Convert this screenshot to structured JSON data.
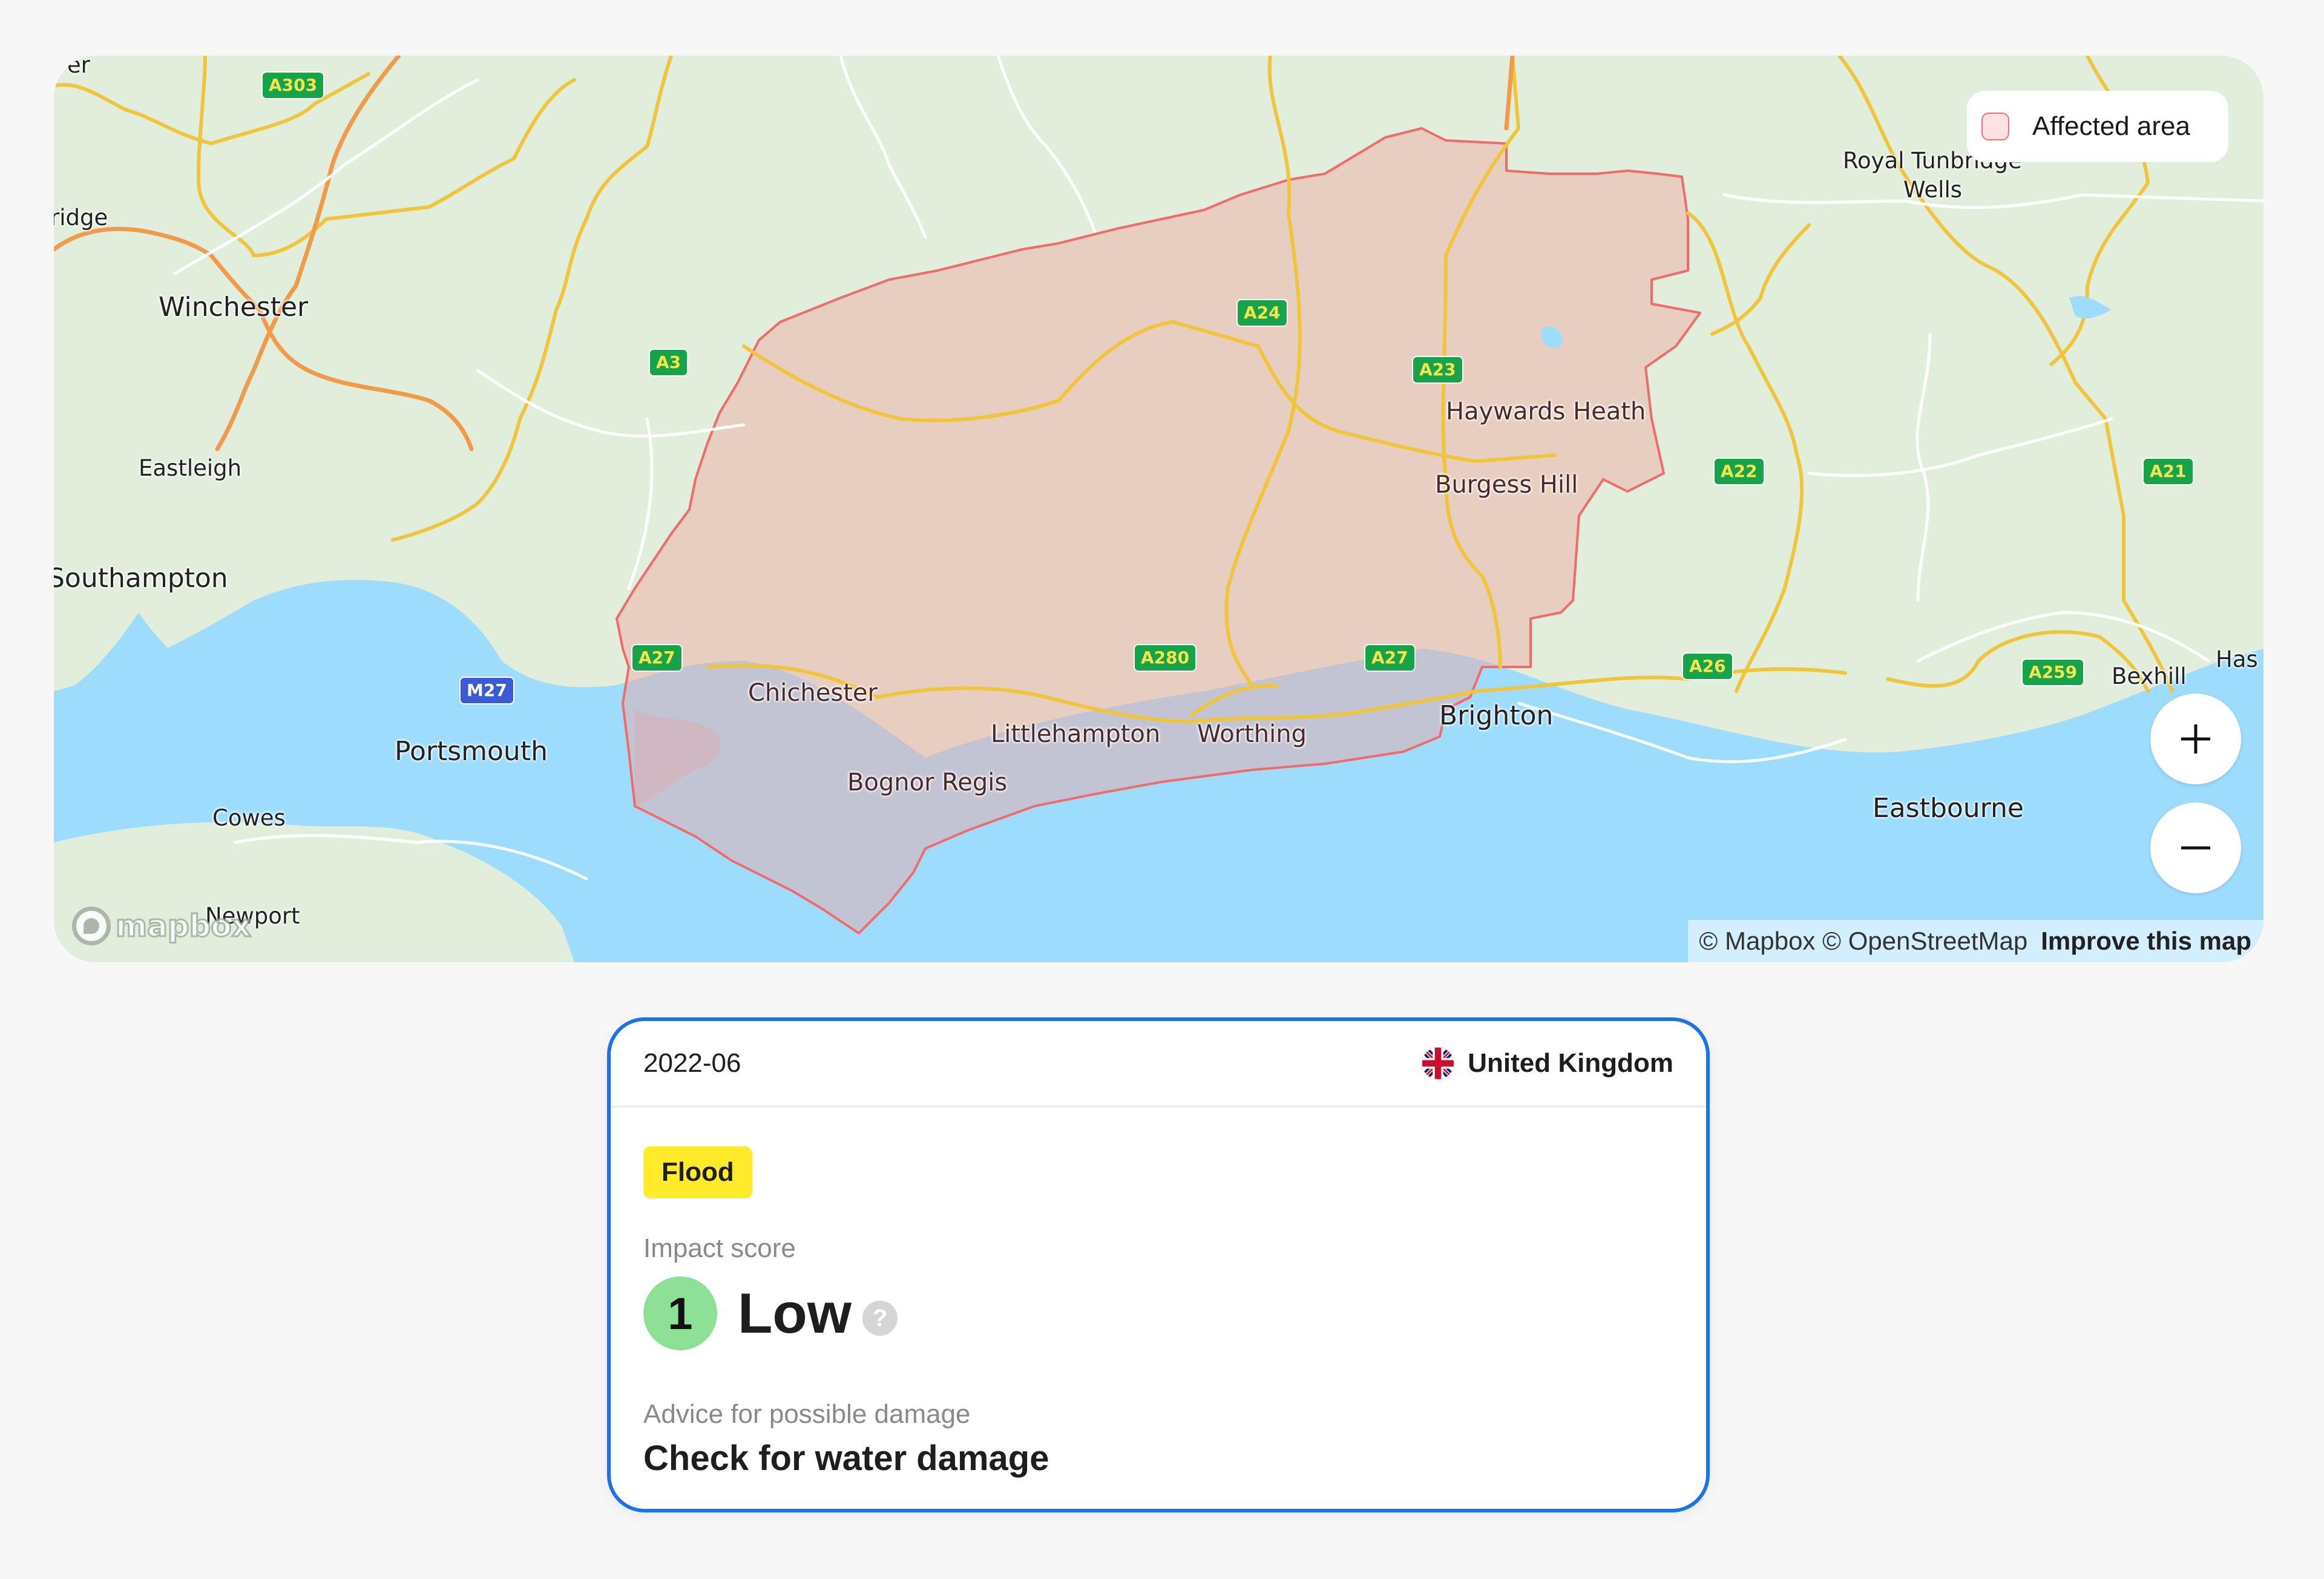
{
  "map": {
    "colors": {
      "land": "#e1eedb",
      "water": "#9ddcfd",
      "affected_fill": "#f2b8b4",
      "affected_stroke": "#f26b6b",
      "a_road": "#f0c53c",
      "motorway_like": "#f2994a"
    },
    "legend": {
      "label": "Affected area"
    },
    "places": [
      {
        "name": "Winchester",
        "size": "big"
      },
      {
        "name": "Eastleigh",
        "size": "small"
      },
      {
        "name": "Southampton",
        "size": "big"
      },
      {
        "name": "Portsmouth",
        "size": "big"
      },
      {
        "name": "Cowes",
        "size": "small"
      },
      {
        "name": "Newport",
        "size": "small"
      },
      {
        "name": "ridge",
        "size": "small"
      },
      {
        "name": "ver",
        "size": "small"
      },
      {
        "name": "Chichester",
        "size": "mid"
      },
      {
        "name": "Bognor Regis",
        "size": "mid"
      },
      {
        "name": "Littlehampton",
        "size": "mid"
      },
      {
        "name": "Worthing",
        "size": "mid"
      },
      {
        "name": "Haywards Heath",
        "size": "mid"
      },
      {
        "name": "Burgess Hill",
        "size": "mid"
      },
      {
        "name": "Brighton",
        "size": "big"
      },
      {
        "name": "Royal Tunbridge",
        "size": "small"
      },
      {
        "name": "Wells",
        "size": "small"
      },
      {
        "name": "Eastbourne",
        "size": "big"
      },
      {
        "name": "Bexhill",
        "size": "small"
      },
      {
        "name": "Has",
        "size": "small"
      }
    ],
    "road_shields": [
      "A303",
      "A3",
      "A24",
      "A23",
      "A22",
      "A21",
      "A27",
      "A280",
      "A27",
      "A26",
      "A259",
      "M27"
    ],
    "zoom_in_label": "+",
    "zoom_out_label": "−",
    "attribution": {
      "mapbox": "© Mapbox",
      "osm": "© OpenStreetMap",
      "improve": "Improve this map"
    },
    "logo_text": "mapbox"
  },
  "event": {
    "date": "2022-06",
    "country": "United Kingdom",
    "country_flag": "uk-flag-icon",
    "type_tag": "Flood",
    "tag_color": "#ffeb2a",
    "impact_label": "Impact score",
    "impact_score": "1",
    "impact_level": "Low",
    "impact_color": "#8de096",
    "help_glyph": "?",
    "advice_label": "Advice for possible damage",
    "advice": "Check for water damage"
  },
  "card_border_color": "#1a73e8"
}
